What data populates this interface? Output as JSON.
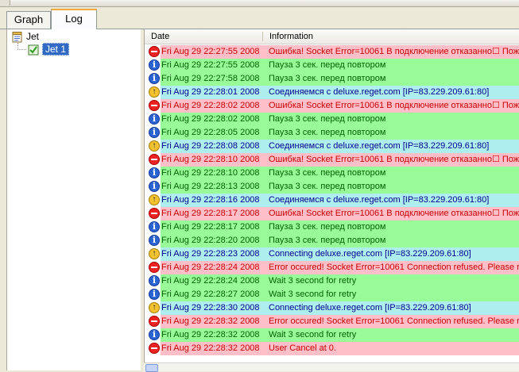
{
  "tabs": {
    "graph": "Graph",
    "log": "Log"
  },
  "tree": {
    "root": "Jet",
    "child": "Jet 1"
  },
  "columns": {
    "date": "Date",
    "information": "Information"
  },
  "rows": [
    {
      "type": "error",
      "date": "Fri Aug 29 22:27:55 2008",
      "msg": "Ошибка! Socket Error=10061 В подключение отказанно☐ Пож"
    },
    {
      "type": "info",
      "date": "Fri Aug 29 22:27:55 2008",
      "msg": "Пауза 3 сек. перед повтором"
    },
    {
      "type": "info",
      "date": "Fri Aug 29 22:27:58 2008",
      "msg": "Пауза 3 сек. перед повтором"
    },
    {
      "type": "connect",
      "date": "Fri Aug 29 22:28:01 2008",
      "msg": "Соединяемся с deluxe.reget.com [IP=83.229.209.61:80]"
    },
    {
      "type": "error",
      "date": "Fri Aug 29 22:28:02 2008",
      "msg": "Ошибка! Socket Error=10061 В подключение отказанно☐ Пож"
    },
    {
      "type": "info",
      "date": "Fri Aug 29 22:28:02 2008",
      "msg": "Пауза 3 сек. перед повтором"
    },
    {
      "type": "info",
      "date": "Fri Aug 29 22:28:05 2008",
      "msg": "Пауза 3 сек. перед повтором"
    },
    {
      "type": "connect",
      "date": "Fri Aug 29 22:28:08 2008",
      "msg": "Соединяемся с deluxe.reget.com [IP=83.229.209.61:80]"
    },
    {
      "type": "error",
      "date": "Fri Aug 29 22:28:10 2008",
      "msg": "Ошибка! Socket Error=10061 В подключение отказанно☐ Пож"
    },
    {
      "type": "info",
      "date": "Fri Aug 29 22:28:10 2008",
      "msg": "Пауза 3 сек. перед повтором"
    },
    {
      "type": "info",
      "date": "Fri Aug 29 22:28:13 2008",
      "msg": "Пауза 3 сек. перед повтором"
    },
    {
      "type": "connect",
      "date": "Fri Aug 29 22:28:16 2008",
      "msg": "Соединяемся с deluxe.reget.com [IP=83.229.209.61:80]"
    },
    {
      "type": "error",
      "date": "Fri Aug 29 22:28:17 2008",
      "msg": "Ошибка! Socket Error=10061 В подключение отказанно☐ Пож"
    },
    {
      "type": "info",
      "date": "Fri Aug 29 22:28:17 2008",
      "msg": "Пауза 3 сек. перед повтором"
    },
    {
      "type": "info",
      "date": "Fri Aug 29 22:28:20 2008",
      "msg": "Пауза 3 сек. перед повтором"
    },
    {
      "type": "connect",
      "date": "Fri Aug 29 22:28:23 2008",
      "msg": "Connecting deluxe.reget.com [IP=83.229.209.61:80]"
    },
    {
      "type": "error",
      "date": "Fri Aug 29 22:28:24 2008",
      "msg": "Error occured! Socket Error=10061 Connection refused. Please re"
    },
    {
      "type": "info",
      "date": "Fri Aug 29 22:28:24 2008",
      "msg": "Wait 3 second for retry"
    },
    {
      "type": "info",
      "date": "Fri Aug 29 22:28:27 2008",
      "msg": "Wait 3 second for retry"
    },
    {
      "type": "connect",
      "date": "Fri Aug 29 22:28:30 2008",
      "msg": "Connecting deluxe.reget.com [IP=83.229.209.61:80]"
    },
    {
      "type": "error",
      "date": "Fri Aug 29 22:28:32 2008",
      "msg": "Error occured! Socket Error=10061 Connection refused. Please re"
    },
    {
      "type": "info",
      "date": "Fri Aug 29 22:28:32 2008",
      "msg": "Wait 3 second for retry"
    },
    {
      "type": "error",
      "date": "Fri Aug 29 22:28:32 2008",
      "msg": "User Cancel at 0."
    }
  ],
  "icons": {
    "error": "error-stop-icon",
    "info": "info-icon",
    "connect": "connect-arrow-icon"
  },
  "colors": {
    "error_bg": "#ffbfc9",
    "info_bg": "#98fb98",
    "connect_bg": "#aeeeee",
    "error_text": "#c80000",
    "info_text": "#006400",
    "connect_text": "#00008b",
    "tab_accent": "#f2a93b",
    "selection": "#316ac5"
  }
}
